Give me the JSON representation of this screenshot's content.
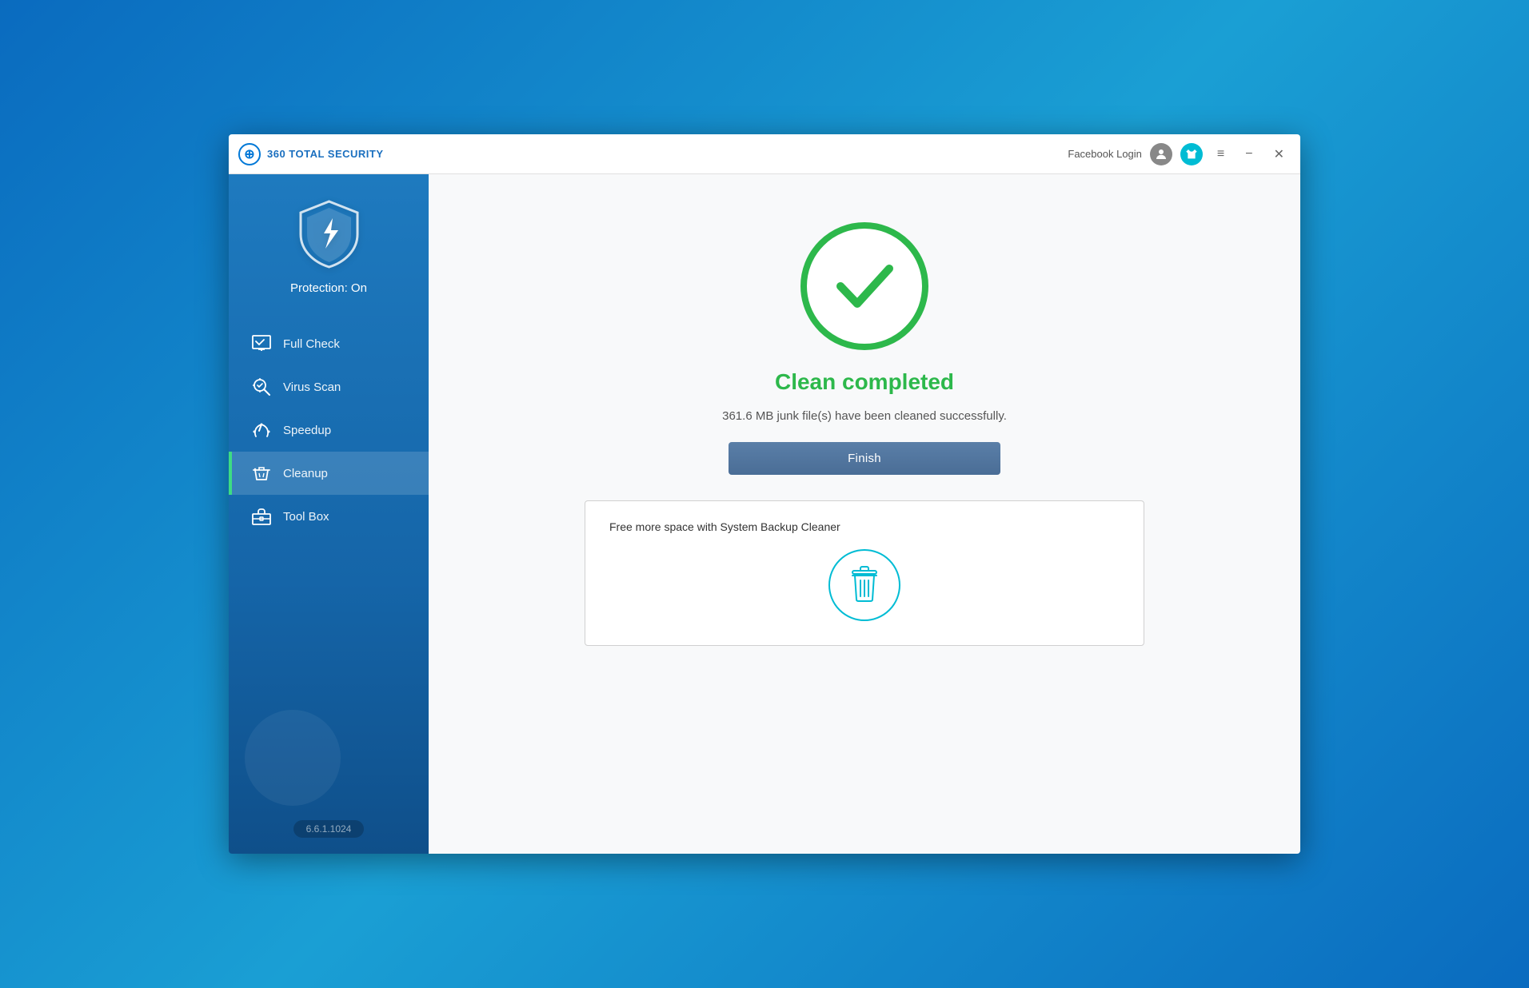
{
  "app": {
    "title": "360 TOTAL SECURITY",
    "version": "6.6.1.1024"
  },
  "titlebar": {
    "facebook_login": "Facebook Login",
    "menu_icon": "≡",
    "minimize": "−",
    "close": "✕"
  },
  "sidebar": {
    "protection_label": "Protection: On",
    "nav_items": [
      {
        "id": "full-check",
        "label": "Full Check",
        "active": false
      },
      {
        "id": "virus-scan",
        "label": "Virus Scan",
        "active": false
      },
      {
        "id": "speedup",
        "label": "Speedup",
        "active": false
      },
      {
        "id": "cleanup",
        "label": "Cleanup",
        "active": true
      },
      {
        "id": "tool-box",
        "label": "Tool Box",
        "active": false
      }
    ],
    "version": "6.6.1.1024"
  },
  "content": {
    "clean_completed_title": "Clean completed",
    "clean_subtitle": "361.6 MB junk file(s) have been cleaned successfully.",
    "finish_button": "Finish",
    "backup_card_title": "Free more space with System Backup Cleaner"
  }
}
